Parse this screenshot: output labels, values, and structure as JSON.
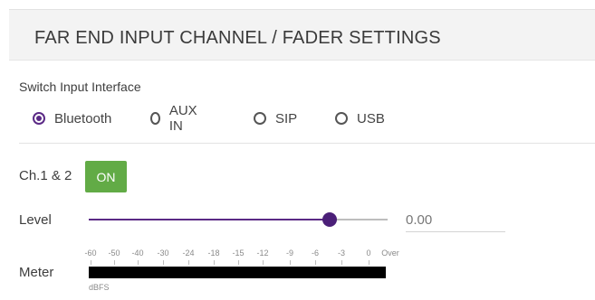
{
  "header": {
    "title": "FAR END INPUT CHANNEL / FADER SETTINGS"
  },
  "switch_input": {
    "label": "Switch Input Interface",
    "options": [
      "Bluetooth",
      "AUX IN",
      "SIP",
      "USB"
    ],
    "selected": "Bluetooth",
    "accent_color": "#5b2a86"
  },
  "channel": {
    "label": "Ch.1 & 2",
    "toggle_label": "ON",
    "toggle_color": "#62ab46"
  },
  "level": {
    "label": "Level",
    "value_text": "0.00",
    "slider_fraction": 0.81
  },
  "meter": {
    "label": "Meter",
    "scale": [
      "-60",
      "-50",
      "-40",
      "-30",
      "-24",
      "-18",
      "-15",
      "-12",
      "-9",
      "-6",
      "-3",
      "0",
      "Over"
    ],
    "unit": "dBFS"
  }
}
